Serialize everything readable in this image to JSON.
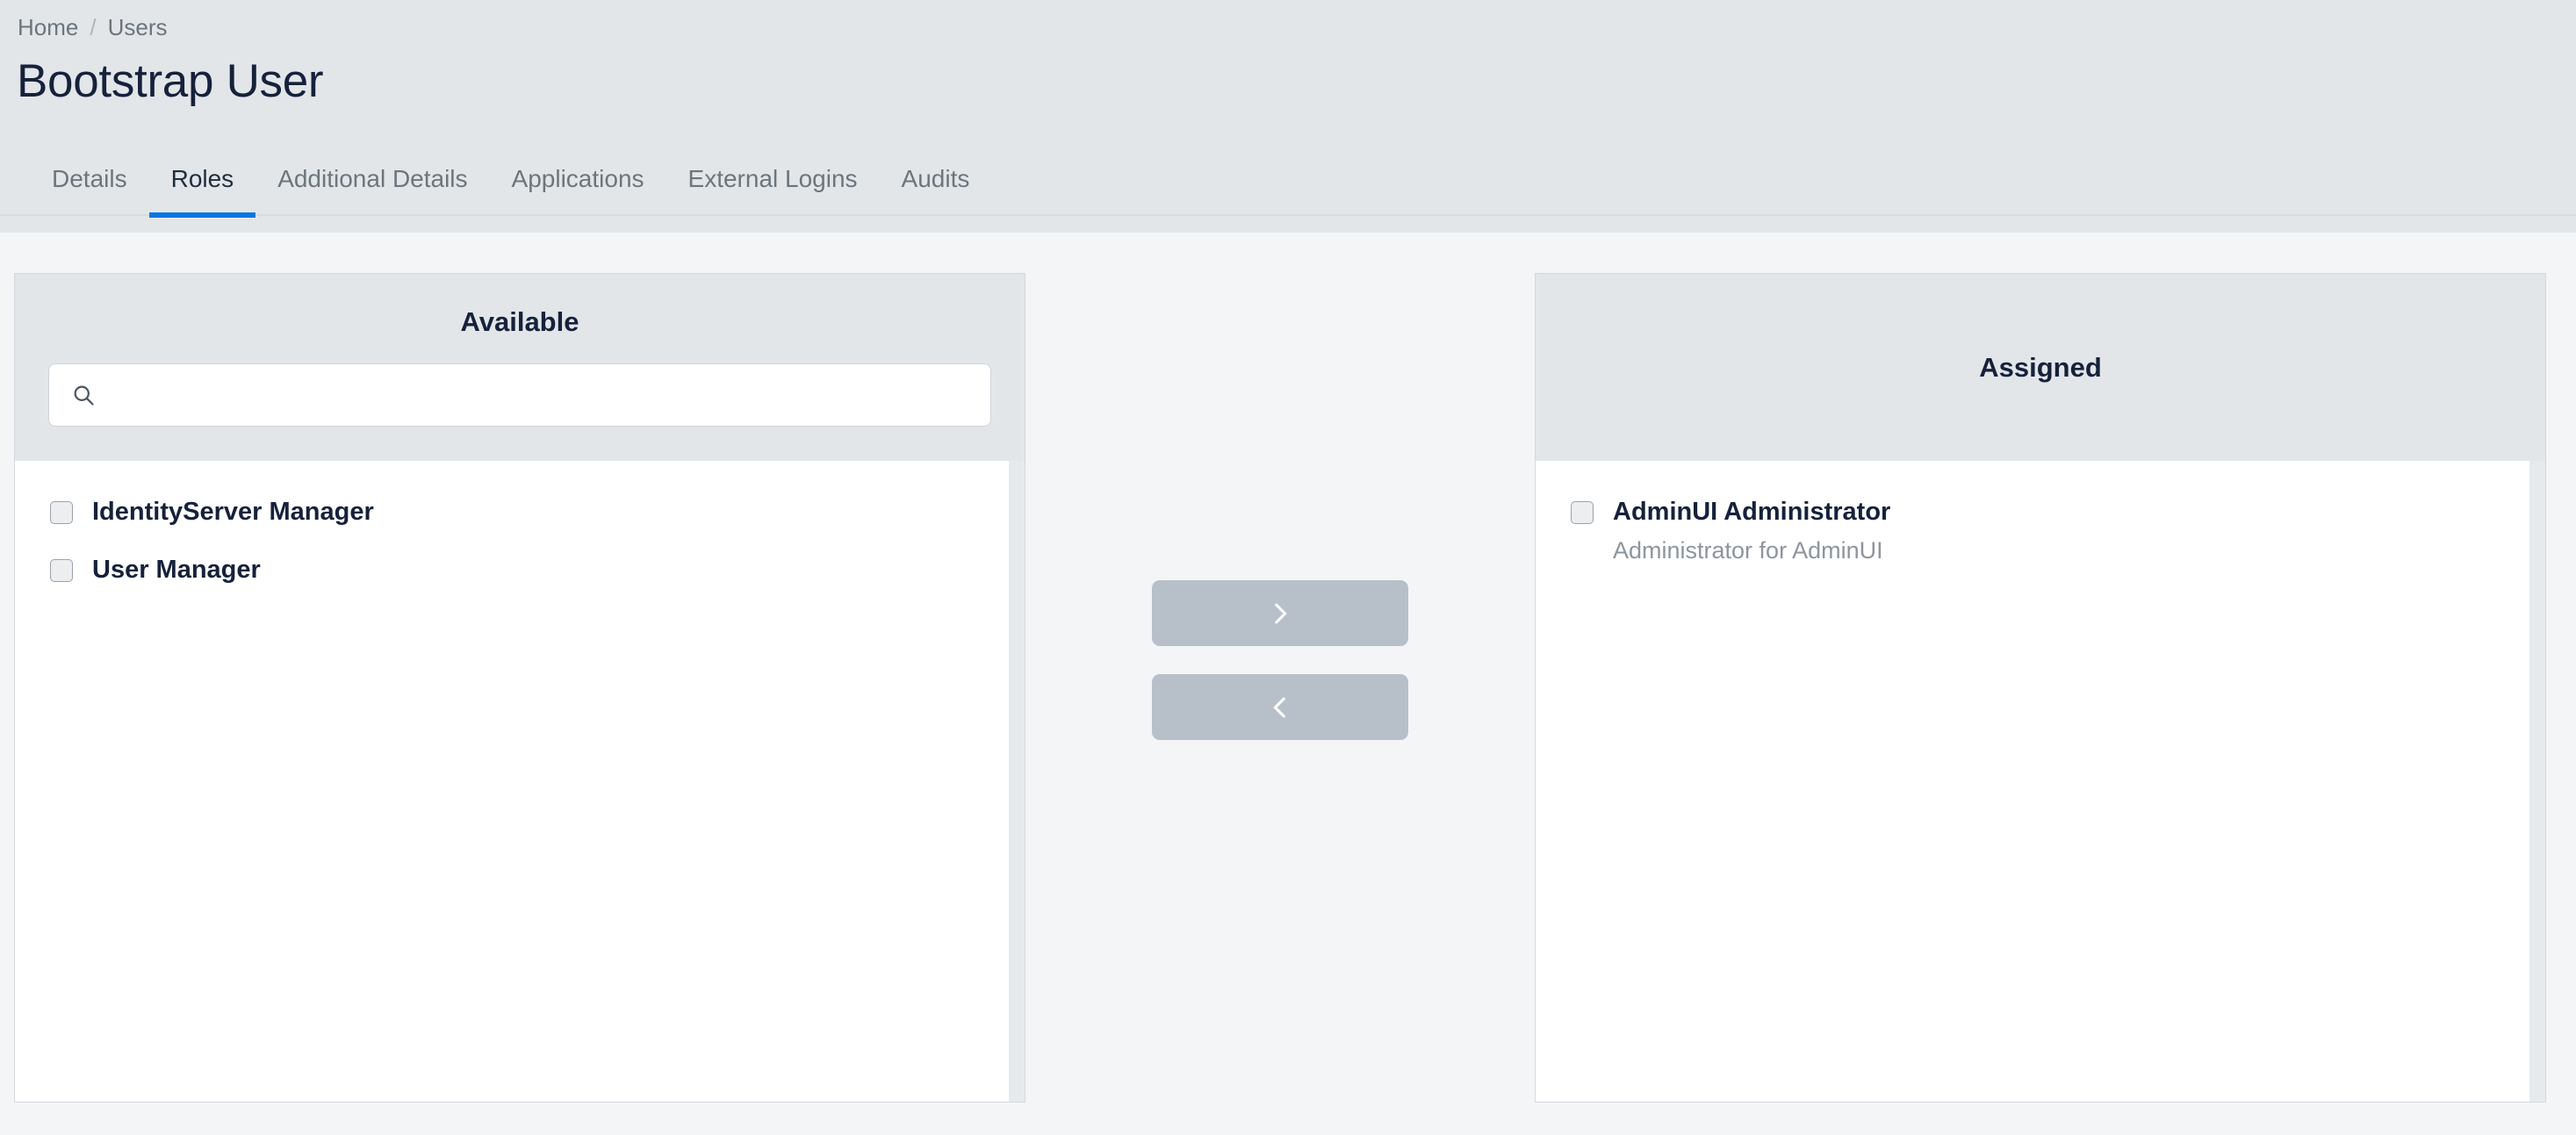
{
  "breadcrumb": {
    "items": [
      "Home",
      "Users"
    ],
    "separator": "/"
  },
  "page": {
    "title": "Bootstrap User"
  },
  "tabs": [
    {
      "label": "Details",
      "active": false
    },
    {
      "label": "Roles",
      "active": true
    },
    {
      "label": "Additional Details",
      "active": false
    },
    {
      "label": "Applications",
      "active": false
    },
    {
      "label": "External Logins",
      "active": false
    },
    {
      "label": "Audits",
      "active": false
    }
  ],
  "available": {
    "title": "Available",
    "search": {
      "value": "",
      "placeholder": "",
      "icon": "search-icon"
    },
    "items": [
      {
        "label": "IdentityServer Manager",
        "description": "",
        "checked": false
      },
      {
        "label": "User Manager",
        "description": "",
        "checked": false
      }
    ]
  },
  "assigned": {
    "title": "Assigned",
    "items": [
      {
        "label": "AdminUI Administrator",
        "description": "Administrator for AdminUI",
        "checked": false
      }
    ]
  },
  "actions": {
    "assign": {
      "icon": "chevron-right-icon",
      "label": ""
    },
    "unassign": {
      "icon": "chevron-left-icon",
      "label": ""
    }
  },
  "colors": {
    "header_background": "#e2e6e9",
    "content_background": "#f4f5f7",
    "active_tab_accent": "#0b74e5",
    "muted_text": "#6c757d",
    "title_text": "#16213b",
    "transfer_button": "#b7bfc9",
    "panel_border": "#d2d9de"
  }
}
